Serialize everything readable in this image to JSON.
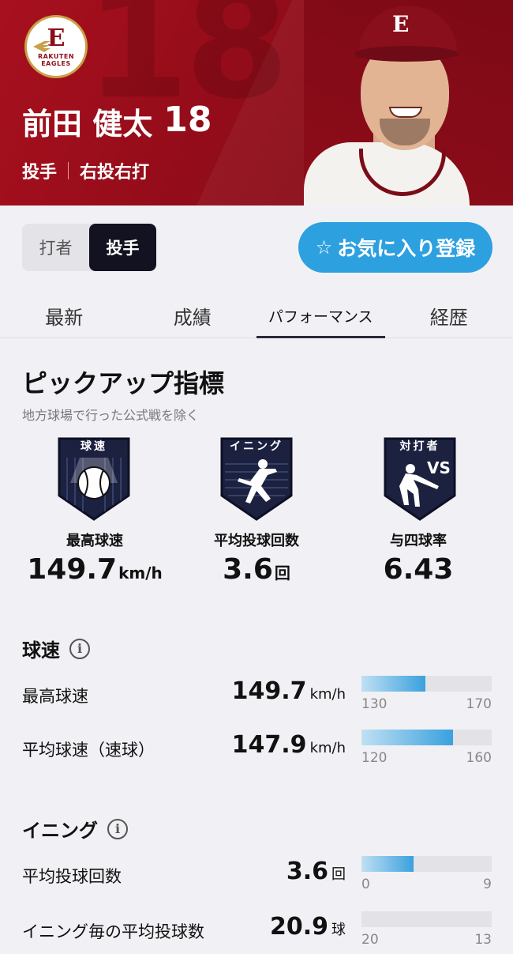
{
  "header": {
    "team_logo_text": "RAKUTEN",
    "team_logo_text2": "EAGLES",
    "team_logo_mark": "E",
    "bg_number": "18",
    "player_name": "前田 健太",
    "uniform_number": "18",
    "position": "投手",
    "throw_bat": "右投右打"
  },
  "toggle": {
    "options": [
      "打者",
      "投手"
    ],
    "selected": "投手"
  },
  "favorite_button": {
    "icon": "star-outline-icon",
    "label": "お気に入り登録"
  },
  "tabs": [
    {
      "label": "最新"
    },
    {
      "label": "成績"
    },
    {
      "label": "パフォーマンス",
      "active": true
    },
    {
      "label": "経歴"
    }
  ],
  "pickup": {
    "title": "ピックアップ指標",
    "subtitle": "地方球場で行った公式戦を除く",
    "metrics": [
      {
        "badge_label": "球速",
        "badge_icon": "baseball-icon",
        "name": "最高球速",
        "value": "149.7",
        "unit": "km/h"
      },
      {
        "badge_label": "イニング",
        "badge_icon": "pitcher-icon",
        "name": "平均投球回数",
        "value": "3.6",
        "unit": "回"
      },
      {
        "badge_label": "対打者",
        "badge_icon": "batter-vs-icon",
        "badge_sub": "VS",
        "name": "与四球率",
        "value": "6.43",
        "unit": ""
      }
    ]
  },
  "sections": [
    {
      "title": "球速",
      "rows": [
        {
          "label": "最高球速",
          "value": "149.7",
          "unit": "km/h",
          "scale_min": "130",
          "scale_max": "170",
          "fill_fraction": 0.49
        },
        {
          "label": "平均球速（速球）",
          "value": "147.9",
          "unit": "km/h",
          "scale_min": "120",
          "scale_max": "160",
          "fill_fraction": 0.7
        }
      ]
    },
    {
      "title": "イニング",
      "rows": [
        {
          "label": "平均投球回数",
          "value": "3.6",
          "unit": "回",
          "scale_min": "0",
          "scale_max": "9",
          "fill_fraction": 0.4
        },
        {
          "label": "イニング毎の平均投球数",
          "value": "20.9",
          "unit": "球",
          "scale_min": "20",
          "scale_max": "13",
          "fill_fraction": 0.0
        }
      ]
    }
  ],
  "colors": {
    "header_red": "#9e0e1c",
    "accent_blue": "#2da0e0",
    "badge_navy": "#1c2140"
  }
}
